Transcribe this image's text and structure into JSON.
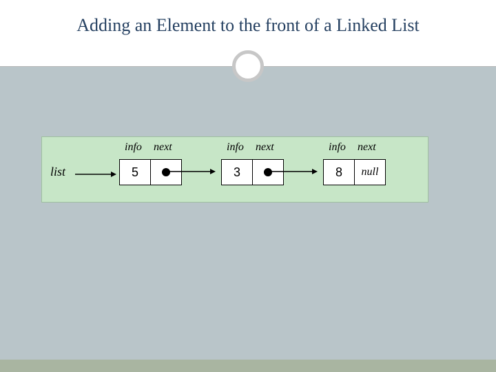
{
  "title": "Adding an Element to the front of a Linked List",
  "list_label": "list",
  "field_labels": {
    "info": "info",
    "next": "next"
  },
  "nodes": [
    {
      "info": "5",
      "next": "ptr"
    },
    {
      "info": "3",
      "next": "ptr"
    },
    {
      "info": "8",
      "next": "null"
    }
  ],
  "null_text": "null",
  "colors": {
    "title": "#254061",
    "body_bg": "#b9c5c9",
    "diagram_bg": "#c7e6c7",
    "footer": "#a9b5a1",
    "ring": "#c7c7c7"
  }
}
